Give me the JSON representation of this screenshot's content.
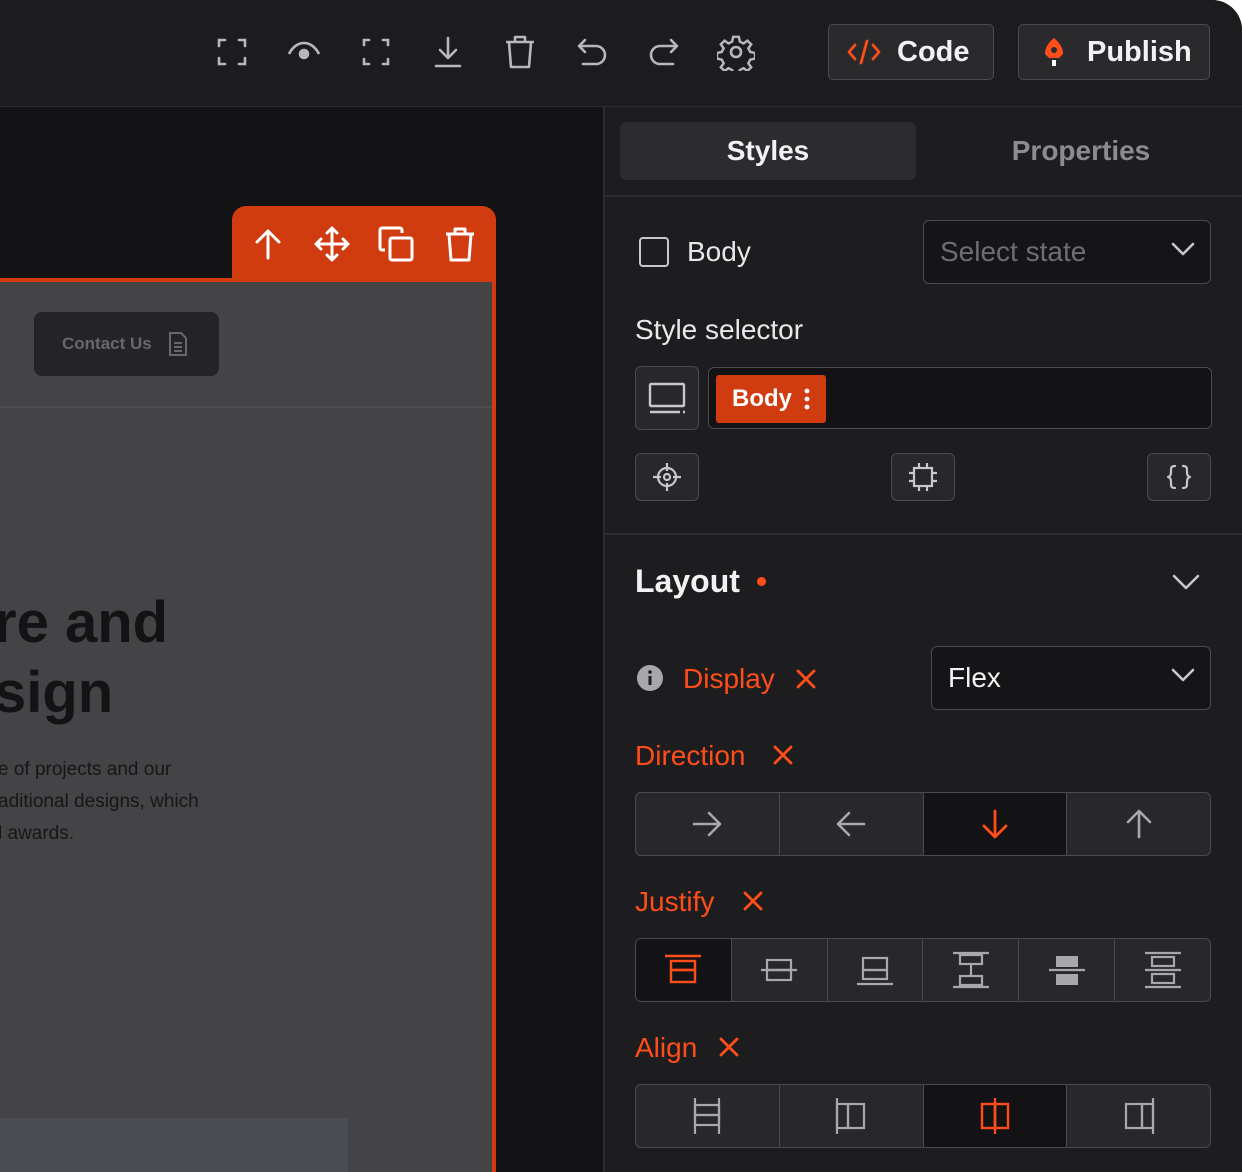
{
  "toolbar": {
    "icons": [
      "fullscreen-icon",
      "eye-icon",
      "frame-icon",
      "download-icon",
      "trash-icon",
      "undo-icon",
      "redo-icon",
      "gear-icon"
    ],
    "code_label": "Code",
    "publish_label": "Publish"
  },
  "canvas": {
    "contact_label": "Contact Us",
    "heading_line1": "re and",
    "heading_line2": "sign",
    "para_line1": "e of projects and our",
    "para_line2": "aditional designs, which",
    "para_line3": "l awards."
  },
  "panel": {
    "tabs": [
      {
        "label": "Styles",
        "active": true
      },
      {
        "label": "Properties",
        "active": false
      }
    ],
    "body_checkbox_label": "Body",
    "select_state_placeholder": "Select state",
    "style_selector_label": "Style selector",
    "selector_tag": "Body",
    "layout": {
      "title": "Layout",
      "display_label": "Display",
      "display_value": "Flex",
      "direction_label": "Direction",
      "direction_options": [
        "row",
        "row-reverse",
        "column",
        "column-reverse"
      ],
      "direction_selected": "column",
      "justify_label": "Justify",
      "justify_options": [
        "flex-start",
        "center",
        "flex-end",
        "space-between",
        "space-around",
        "space-evenly"
      ],
      "justify_selected": "flex-start",
      "align_label": "Align",
      "align_options": [
        "stretch",
        "flex-start",
        "center",
        "flex-end"
      ],
      "align_selected": "center"
    }
  },
  "colors": {
    "accent": "#ff4d1a",
    "selection": "#d13b10",
    "panel_bg": "#1d1d1f",
    "canvas_bg": "#131315"
  }
}
